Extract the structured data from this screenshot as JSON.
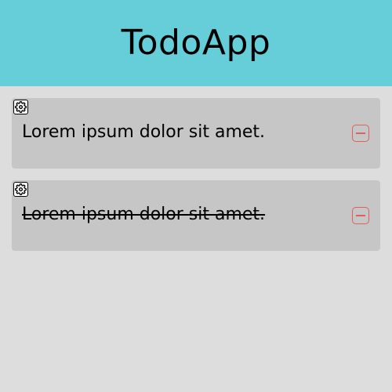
{
  "header": {
    "title": "TodoApp"
  },
  "colors": {
    "header_bg": "#66ced9",
    "page_bg": "#dddddd",
    "item_bg": "#c6c6c6",
    "remove_accent": "#e06060"
  },
  "todos": [
    {
      "text": "Lorem ipsum dolor sit amet.",
      "completed": false,
      "settings_icon": "gear-icon",
      "remove_icon": "minus-square-icon"
    },
    {
      "text": "Lorem ipsum dolor sit amet.",
      "completed": true,
      "settings_icon": "gear-icon",
      "remove_icon": "minus-square-icon"
    }
  ]
}
